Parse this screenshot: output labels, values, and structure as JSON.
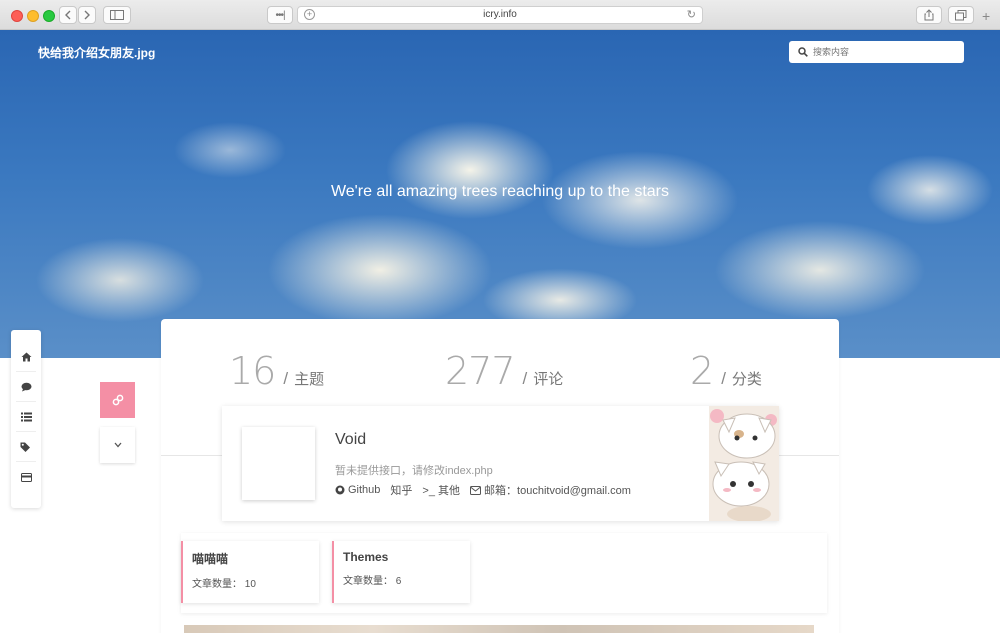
{
  "browser": {
    "url": "icry.info"
  },
  "site": {
    "title": "快给我介绍女朋友.jpg",
    "search_placeholder": "搜索内容",
    "tagline": "We're all amazing trees reaching up to the stars"
  },
  "stats": [
    {
      "value": "16",
      "sep": "/",
      "label": "主题"
    },
    {
      "value": "277",
      "sep": "/",
      "label": "评论"
    },
    {
      "value": "2",
      "sep": "/",
      "label": "分类"
    }
  ],
  "profile": {
    "name": "Void",
    "description": "暂未提供接口，请修改index.php",
    "links": {
      "github": "Github",
      "zhihu": "知乎",
      "other": ">_ 其他",
      "email": "邮箱：touchitvoid@gmail.com"
    }
  },
  "categories": [
    {
      "name": "喵喵喵",
      "count": "文章数量： 10"
    },
    {
      "name": "Themes",
      "count": "文章数量： 6"
    }
  ],
  "colors": {
    "accent": "#f48fa5",
    "sky": "#3b79c0"
  },
  "icons": {
    "nav": [
      "home-icon",
      "comment-icon",
      "list-icon",
      "tags-icon",
      "card-icon"
    ]
  }
}
